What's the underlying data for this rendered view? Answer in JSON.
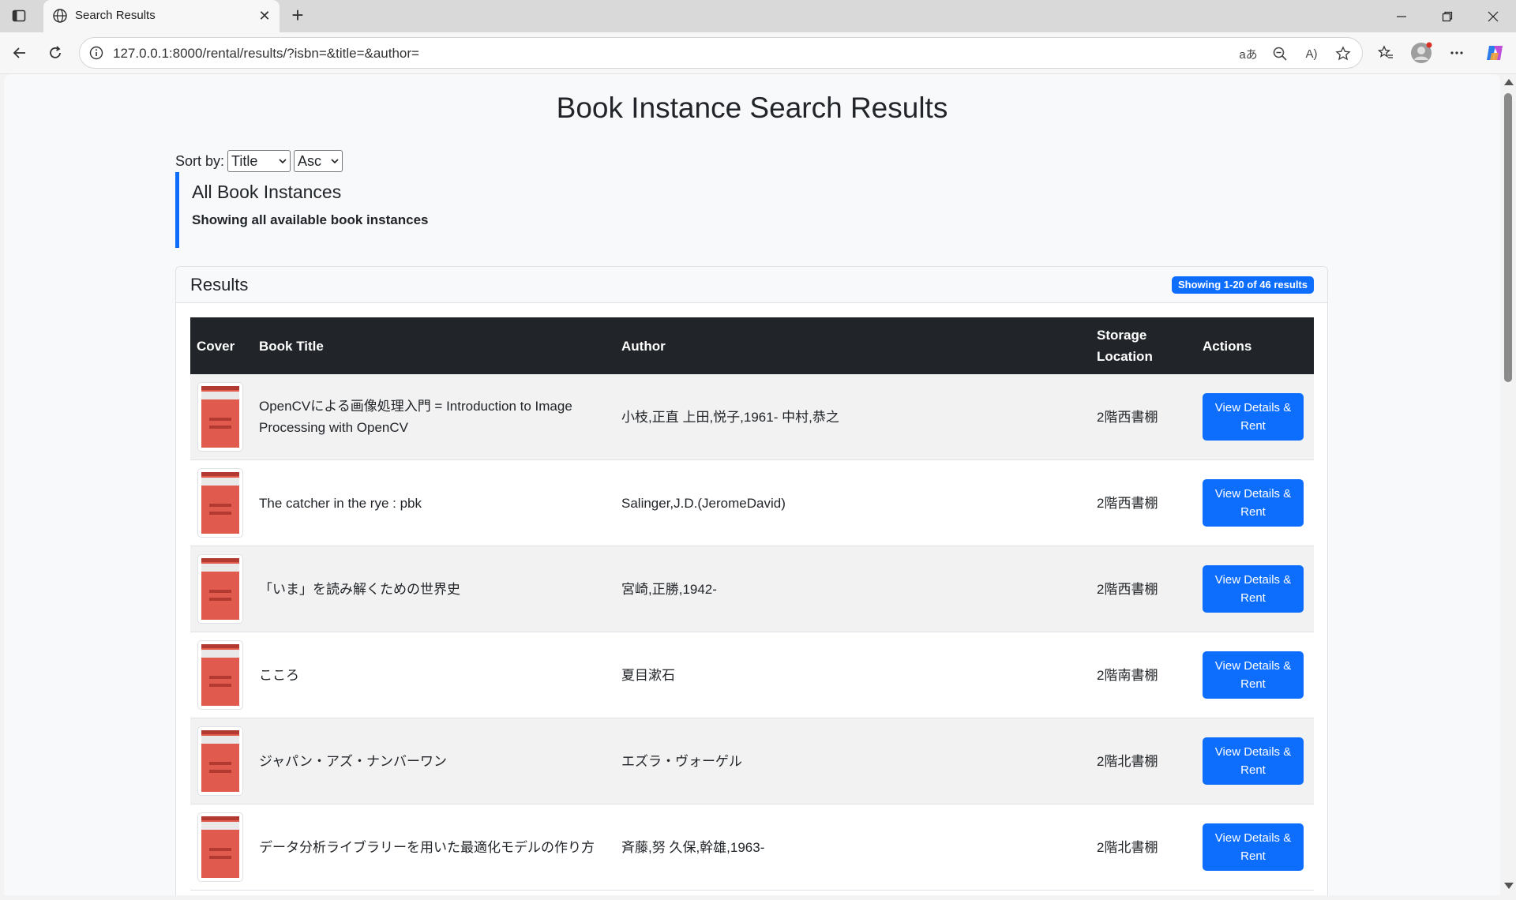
{
  "browser": {
    "tab_title": "Search Results",
    "url": "127.0.0.1:8000/rental/results/?isbn=&title=&author="
  },
  "page": {
    "title": "Book Instance Search Results",
    "sort_label": "Sort by:",
    "sort_field": "Title",
    "sort_order": "Asc",
    "notice_title": "All Book Instances",
    "notice_text": "Showing all available book instances"
  },
  "results": {
    "header": "Results",
    "badge": "Showing 1-20 of 46 results",
    "columns": {
      "cover": "Cover",
      "title": "Book Title",
      "author": "Author",
      "storage_line1": "Storage",
      "storage_line2": "Location",
      "actions": "Actions"
    },
    "button_line1": "View Details &",
    "button_line2": "Rent",
    "rows": [
      {
        "title_line1": "OpenCVによる画像処理入門 = Introduction to Image",
        "title_line2": "Processing with OpenCV",
        "author": "小枝,正直 上田,悦子,1961- 中村,恭之",
        "location": "2階西書棚"
      },
      {
        "title_line1": "The catcher in the rye : pbk",
        "title_line2": "",
        "author": "Salinger,J.D.(JeromeDavid)",
        "location": "2階西書棚"
      },
      {
        "title_line1": "「いま」を読み解くための世界史",
        "title_line2": "",
        "author": "宮崎,正勝,1942-",
        "location": "2階西書棚"
      },
      {
        "title_line1": "こころ",
        "title_line2": "",
        "author": "夏目漱石",
        "location": "2階南書棚"
      },
      {
        "title_line1": "ジャパン・アズ・ナンバーワン",
        "title_line2": "",
        "author": "エズラ・ヴォーゲル",
        "location": "2階北書棚"
      },
      {
        "title_line1": "データ分析ライブラリーを用いた最適化モデルの作り方",
        "title_line2": "",
        "author": "斉藤,努 久保,幹雄,1963-",
        "location": "2階北書棚"
      }
    ]
  },
  "colors": {
    "accent": "#0d6efd",
    "table_head": "#212529",
    "cover": "#e05a4e"
  }
}
